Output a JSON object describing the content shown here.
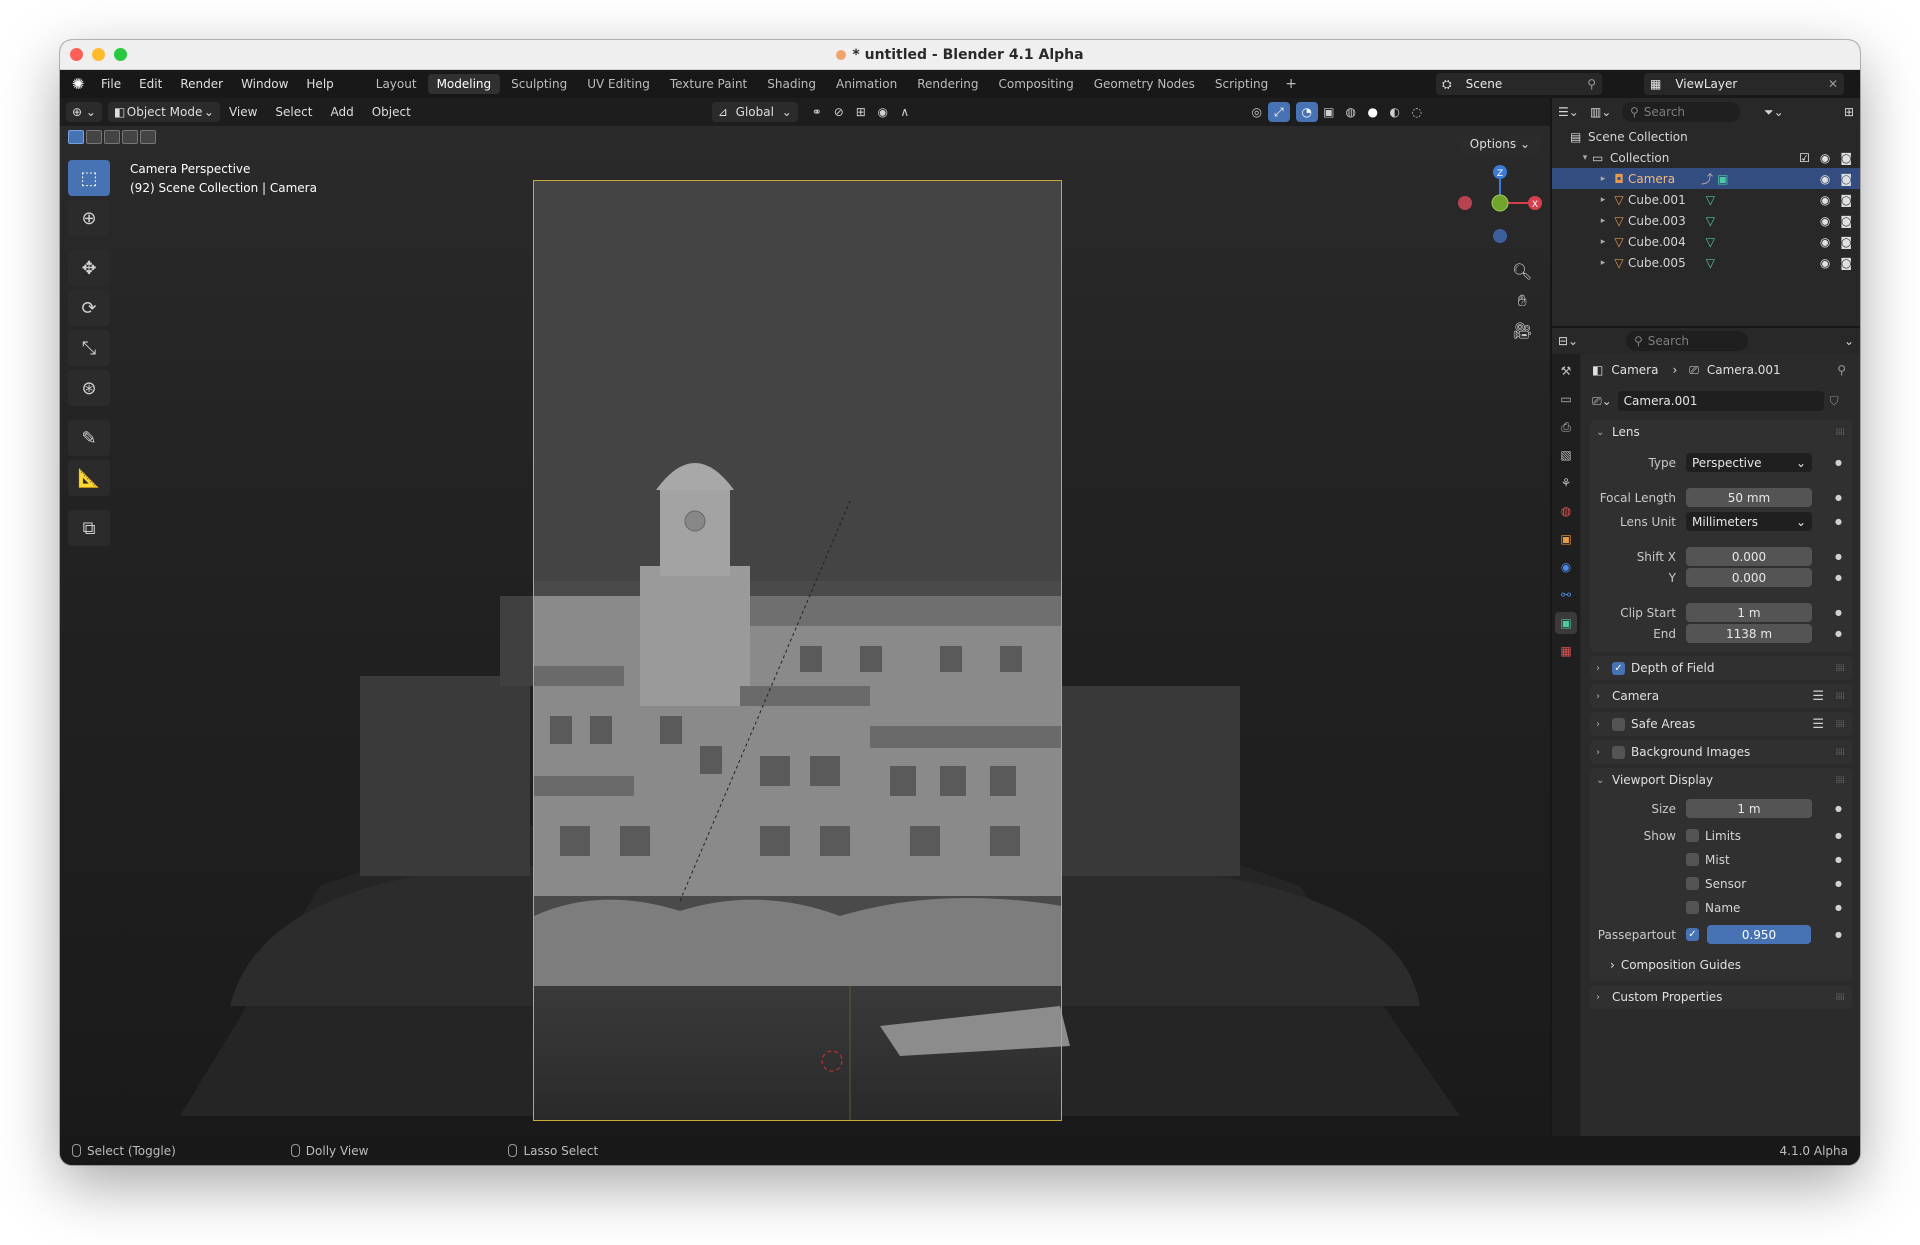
{
  "window": {
    "title": "* untitled - Blender 4.1 Alpha"
  },
  "topbar": {
    "menus": [
      "File",
      "Edit",
      "Render",
      "Window",
      "Help"
    ],
    "workspaces": [
      "Layout",
      "Modeling",
      "Sculpting",
      "UV Editing",
      "Texture Paint",
      "Shading",
      "Animation",
      "Rendering",
      "Compositing",
      "Geometry Nodes",
      "Scripting"
    ],
    "active_workspace": "Modeling",
    "scene": "Scene",
    "view_layer": "ViewLayer"
  },
  "header": {
    "mode": "Object Mode",
    "menus": [
      "View",
      "Select",
      "Add",
      "Object"
    ],
    "transform_orientation": "Global"
  },
  "viewport": {
    "info_line1": "Camera Perspective",
    "info_line2": "(92) Scene Collection | Camera",
    "options_label": "Options",
    "gizmo": {
      "z": "Z",
      "x": "X"
    }
  },
  "outliner": {
    "search_placeholder": "Search",
    "scene_collection": "Scene Collection",
    "collection": "Collection",
    "items": [
      {
        "name": "Camera",
        "selected": true
      },
      {
        "name": "Cube.001",
        "selected": false
      },
      {
        "name": "Cube.003",
        "selected": false
      },
      {
        "name": "Cube.004",
        "selected": false
      },
      {
        "name": "Cube.005",
        "selected": false
      }
    ]
  },
  "properties": {
    "search_placeholder": "Search",
    "breadcrumb": {
      "object": "Camera",
      "data": "Camera.001"
    },
    "datablock": "Camera.001",
    "lens": {
      "title": "Lens",
      "type_label": "Type",
      "type_value": "Perspective",
      "focal_label": "Focal Length",
      "focal_value": "50 mm",
      "unit_label": "Lens Unit",
      "unit_value": "Millimeters",
      "shiftx_label": "Shift X",
      "shiftx_value": "0.000",
      "shifty_label": "Y",
      "shifty_value": "0.000",
      "clipstart_label": "Clip Start",
      "clipstart_value": "1 m",
      "clipend_label": "End",
      "clipend_value": "1138 m"
    },
    "panels": {
      "dof": "Depth of Field",
      "camera": "Camera",
      "safe_areas": "Safe Areas",
      "bg_images": "Background Images",
      "viewport_display": "Viewport Display",
      "custom_props": "Custom Properties"
    },
    "viewport_display": {
      "size_label": "Size",
      "size_value": "1 m",
      "show_label": "Show",
      "limits": "Limits",
      "mist": "Mist",
      "sensor": "Sensor",
      "name": "Name",
      "passepartout_label": "Passepartout",
      "passepartout_value": "0.950",
      "composition_guides": "Composition Guides"
    }
  },
  "statusbar": {
    "select": "Select (Toggle)",
    "dolly": "Dolly View",
    "lasso": "Lasso Select",
    "version": "4.1.0 Alpha"
  }
}
